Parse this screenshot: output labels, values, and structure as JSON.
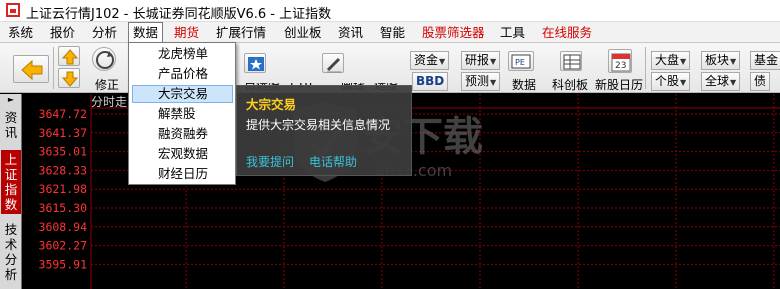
{
  "window": {
    "title": "上证云行情J102 - 长城证券同花顺版V6.6 - 上证指数"
  },
  "menu": {
    "items": [
      {
        "label": "系统",
        "color": "#000000"
      },
      {
        "label": "报价",
        "color": "#000000"
      },
      {
        "label": "分析",
        "color": "#000000"
      },
      {
        "label": "数据",
        "color": "#000000",
        "active": true
      },
      {
        "label": "期货",
        "color": "#d40000"
      },
      {
        "label": "扩展行情",
        "color": "#000000"
      },
      {
        "label": "创业板",
        "color": "#000000"
      },
      {
        "label": "资讯",
        "color": "#000000"
      },
      {
        "label": "智能",
        "color": "#000000"
      },
      {
        "label": "股票筛选器",
        "color": "#d40000"
      },
      {
        "label": "工具",
        "color": "#000000"
      },
      {
        "label": "在线服务",
        "color": "#d40000"
      }
    ]
  },
  "toolbar": {
    "back_icon": "left-arrow-icon",
    "updown_icon": "up-down-arrow-icon",
    "revise_label": "修正",
    "self_select_label": "自选股",
    "f10_label": "F10",
    "draw_label": "画线",
    "select_stock_label": "选股",
    "fund_label": "资金",
    "bbd_label": "BBD",
    "research_label": "研报",
    "forecast_label": "预测",
    "pe_label": "PE",
    "data_label": "数据",
    "chinext_label": "科创板",
    "calendar_day": "23",
    "ipo_calendar_label": "新股日历",
    "broad_market_label": "大盘",
    "individual_label": "个股",
    "sector_label": "板块",
    "global_label": "全球",
    "fund2_label": "基金",
    "bond_label": "债"
  },
  "sidebar": {
    "tabs": [
      {
        "label": "资讯"
      },
      {
        "label": "上证指数",
        "active": true
      },
      {
        "label": "技术分析"
      }
    ]
  },
  "chart": {
    "mode_label": "分时走",
    "price_labels": [
      "3647.72",
      "3641.37",
      "3635.01",
      "3628.33",
      "3621.98",
      "3615.30",
      "3608.94",
      "3602.27",
      "3595.91"
    ],
    "label_color": "#ff3333",
    "grid_color": "#8b0000",
    "reference_line_color": "#ffffff"
  },
  "dropdown": {
    "items": [
      {
        "label": "龙虎榜单"
      },
      {
        "label": "产品价格"
      },
      {
        "label": "大宗交易",
        "highlighted": true
      },
      {
        "label": "解禁股"
      },
      {
        "label": "融资融券"
      },
      {
        "label": "宏观数据"
      },
      {
        "label": "财经日历"
      }
    ]
  },
  "tooltip": {
    "title": "大宗交易",
    "description": "提供大宗交易相关信息情况",
    "ask_link": "我要提问",
    "phone_link": "电话帮助"
  },
  "watermark": {
    "text": "安下载",
    "subtext": "anxz.com"
  }
}
